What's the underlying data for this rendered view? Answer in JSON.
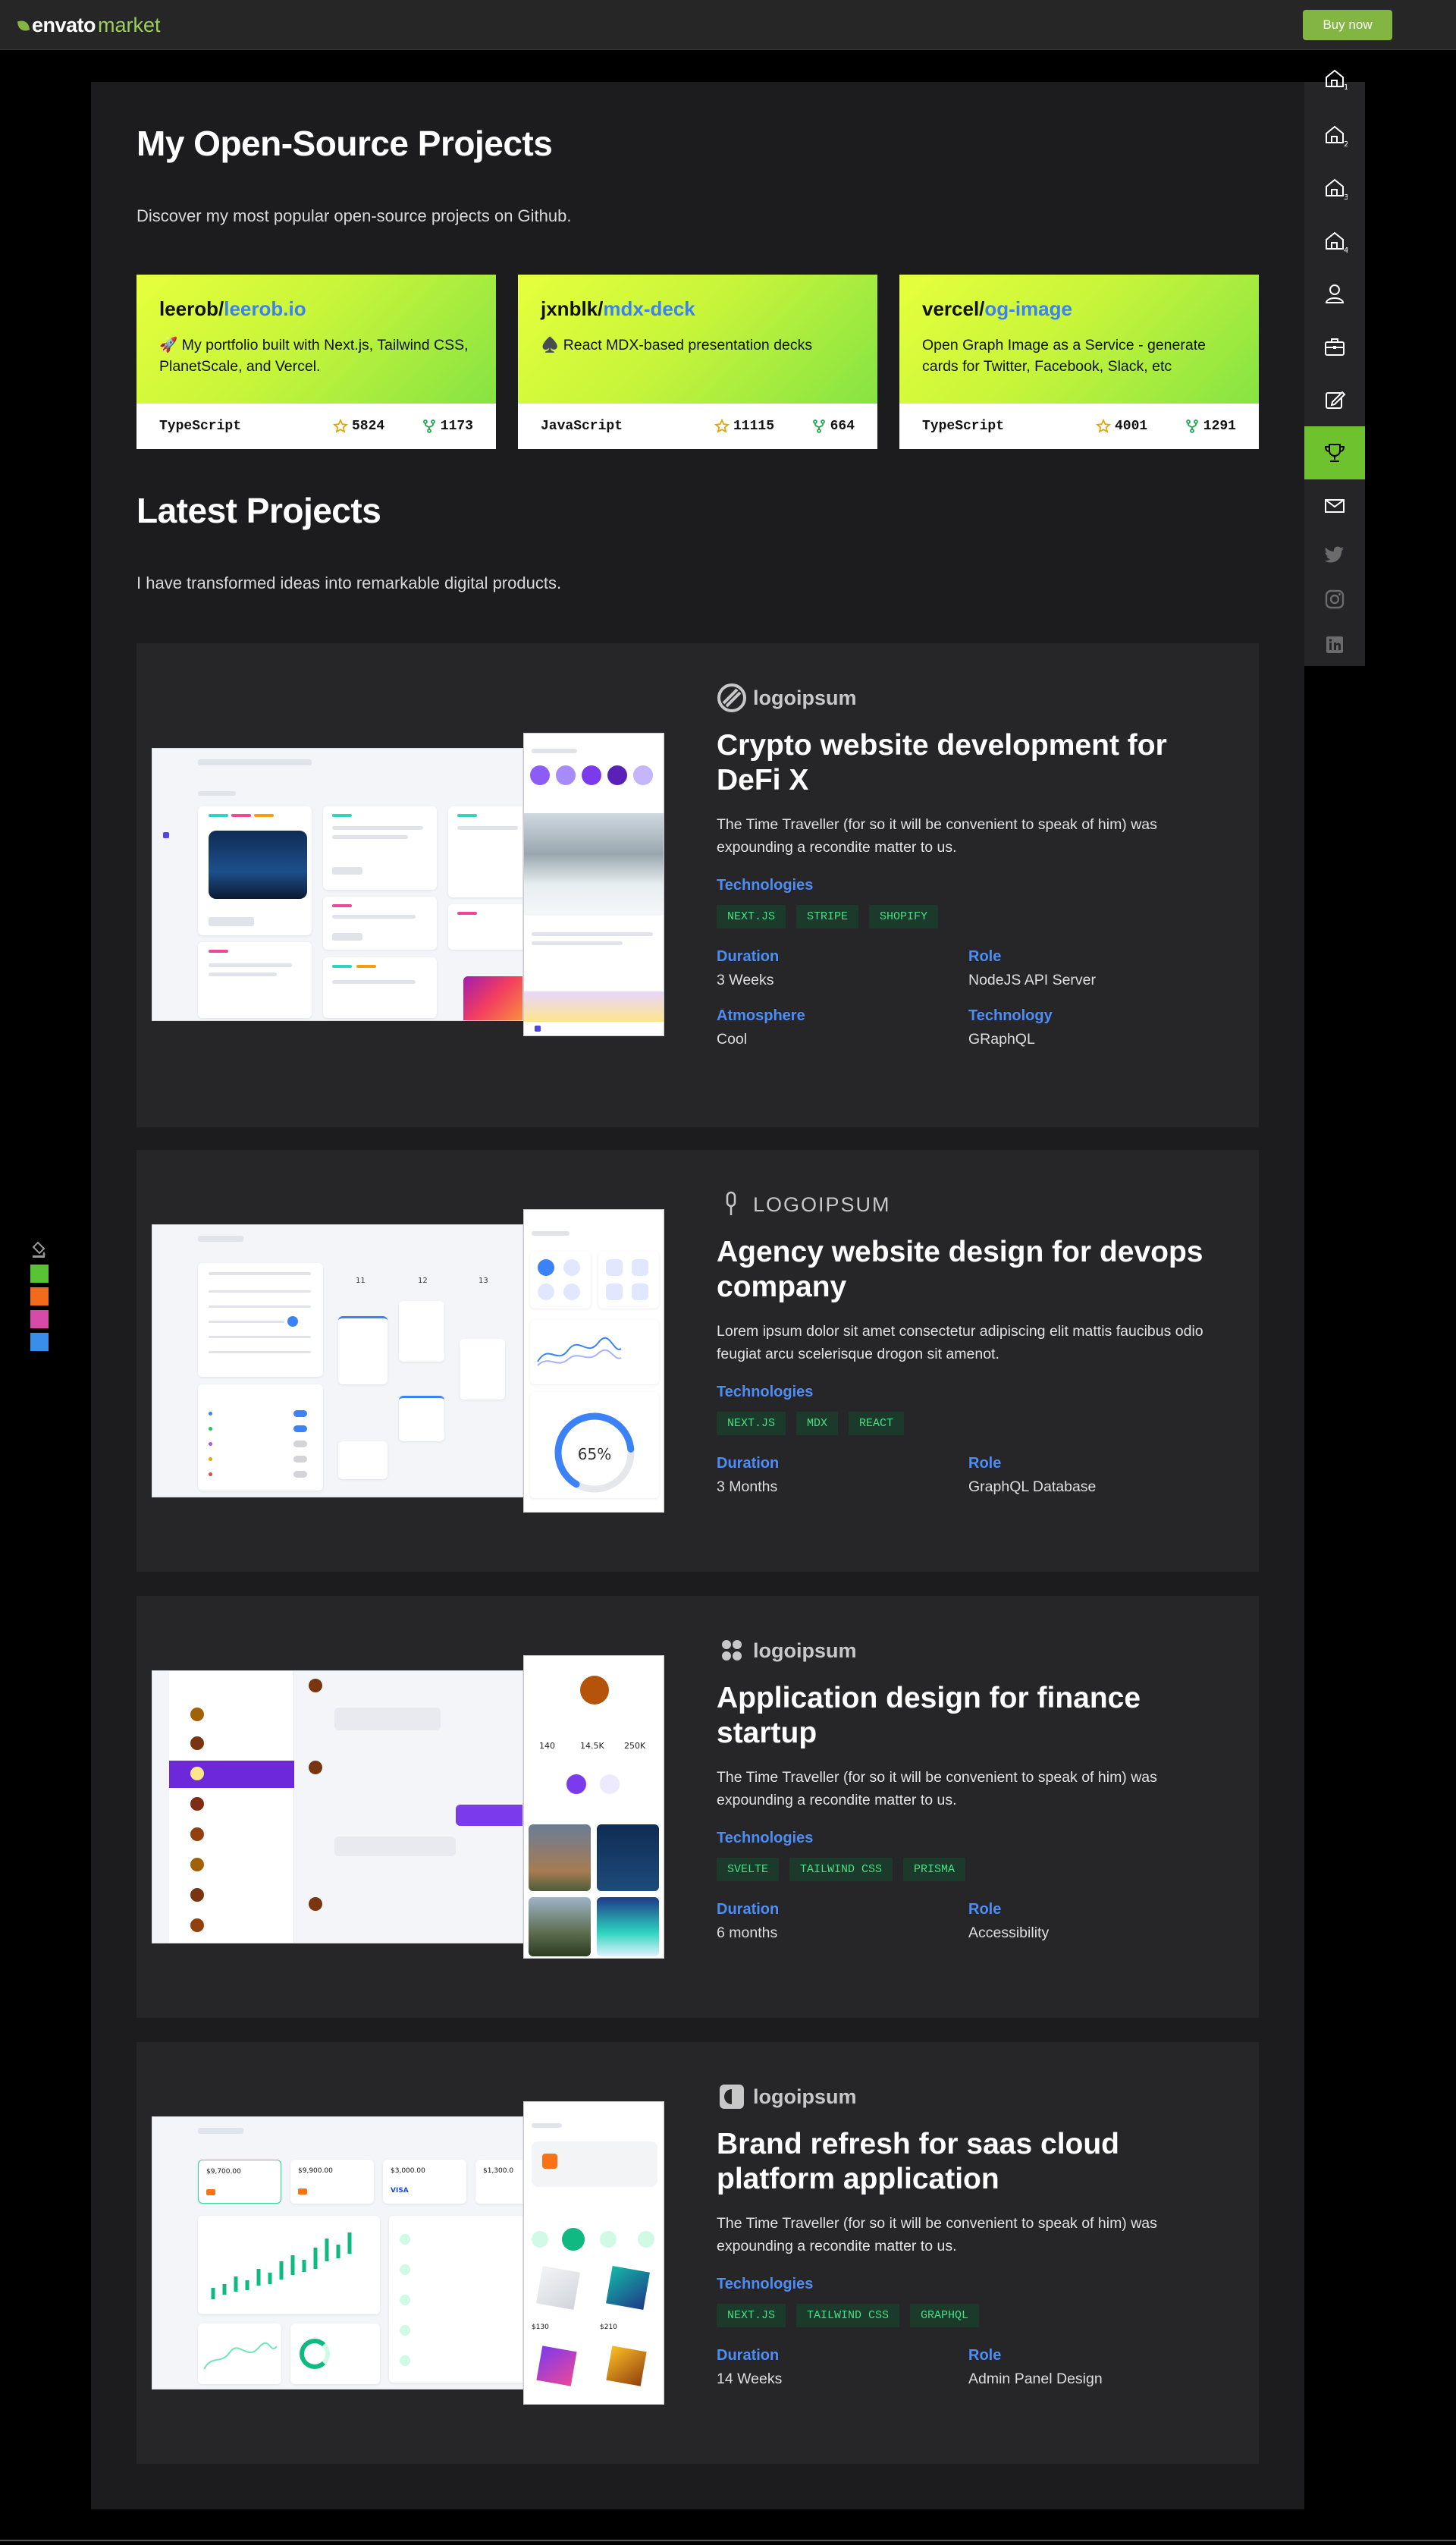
{
  "topbar": {
    "brand_main": "envato",
    "brand_sub": "market",
    "buy_label": "Buy now"
  },
  "oss_section": {
    "title": "My Open-Source Projects",
    "subtitle": "Discover my most popular open-source projects on Github.",
    "cards": [
      {
        "owner": "leerob/",
        "repo": "leerob.io",
        "description": "🚀 My portfolio built with Next.js, Tailwind CSS, PlanetScale, and Vercel.",
        "language": "TypeScript",
        "stars": "5824",
        "forks": "1173"
      },
      {
        "owner": "jxnblk/",
        "repo": "mdx-deck",
        "description": "♠️ React MDX-based presentation decks",
        "language": "JavaScript",
        "stars": "11115",
        "forks": "664"
      },
      {
        "owner": "vercel/",
        "repo": "og-image",
        "description": "Open Graph Image as a Service - generate cards for Twitter, Facebook, Slack, etc",
        "language": "TypeScript",
        "stars": "4001",
        "forks": "1291"
      }
    ]
  },
  "latest_section": {
    "title": "Latest Projects",
    "subtitle": "I have transformed ideas into remarkable digital products."
  },
  "projects": [
    {
      "logo": "logoipsum",
      "title": "Crypto website development for DeFi X",
      "description": "The Time Traveller (for so it will be convenient to speak of him) was expounding a recondite matter to us.",
      "tech_label": "Technologies",
      "tags": [
        "NEXT.JS",
        "STRIPE",
        "SHOPIFY"
      ],
      "meta": [
        {
          "label": "Duration",
          "value": "3 Weeks"
        },
        {
          "label": "Role",
          "value": "NodeJS API Server"
        },
        {
          "label": "Atmosphere",
          "value": "Cool"
        },
        {
          "label": "Technology",
          "value": "GRaphQL"
        }
      ]
    },
    {
      "logo": "LOGOIPSUM",
      "title": "Agency website design for devops company",
      "description": "Lorem ipsum dolor sit amet consectetur adipiscing elit mattis faucibus odio feugiat arcu scelerisque drogon sit amenot.",
      "tech_label": "Technologies",
      "tags": [
        "NEXT.JS",
        "MDX",
        "REACT"
      ],
      "meta": [
        {
          "label": "Duration",
          "value": "3 Months"
        },
        {
          "label": "Role",
          "value": "GraphQL Database"
        }
      ],
      "mock": {
        "cal_days": [
          "11",
          "12",
          "13"
        ],
        "gauge": "65%",
        "gauge_value": 0.65
      }
    },
    {
      "logo": "logoipsum",
      "title": "Application design for finance startup",
      "description": "The Time Traveller (for so it will be convenient to speak of him) was expounding a recondite matter to us.",
      "tech_label": "Technologies",
      "tags": [
        "SVELTE",
        "TAILWIND CSS",
        "PRISMA"
      ],
      "meta": [
        {
          "label": "Duration",
          "value": "6 months"
        },
        {
          "label": "Role",
          "value": "Accessibility"
        }
      ],
      "mock": {
        "stats": [
          "140",
          "14.5K",
          "250K"
        ]
      }
    },
    {
      "logo": "logoipsum",
      "title": "Brand refresh for saas cloud platform application",
      "description": "The Time Traveller (for so it will be convenient to speak of him) was expounding a recondite matter to us.",
      "tech_label": "Technologies",
      "tags": [
        "NEXT.JS",
        "TAILWIND CSS",
        "GRAPHQL"
      ],
      "meta": [
        {
          "label": "Duration",
          "value": "14 Weeks"
        },
        {
          "label": "Role",
          "value": "Admin Panel Design"
        }
      ],
      "mock": {
        "balances": [
          "$9,700.00",
          "$9,900.00",
          "$3,000.00",
          "$1,300.0"
        ],
        "card_brand": "VISA",
        "prices": [
          "$130",
          "$210"
        ]
      }
    }
  ],
  "sidenav": [
    {
      "icon": "home-1-icon",
      "sub": "1"
    },
    {
      "icon": "home-2-icon",
      "sub": "2"
    },
    {
      "icon": "home-3-icon",
      "sub": "3"
    },
    {
      "icon": "home-4-icon",
      "sub": "4"
    },
    {
      "icon": "user-icon"
    },
    {
      "icon": "briefcase-icon"
    },
    {
      "icon": "edit-icon"
    },
    {
      "icon": "trophy-icon"
    },
    {
      "icon": "mail-icon"
    },
    {
      "icon": "twitter-icon"
    },
    {
      "icon": "instagram-icon"
    },
    {
      "icon": "linkedin-icon"
    }
  ],
  "colors": {
    "accent_green": "#6ec22d",
    "link_blue": "#4d8df6",
    "tag_text": "#4ade80",
    "swatches": [
      "#58c334",
      "#f26b1d",
      "#d64ba8",
      "#3b8ee8"
    ]
  }
}
